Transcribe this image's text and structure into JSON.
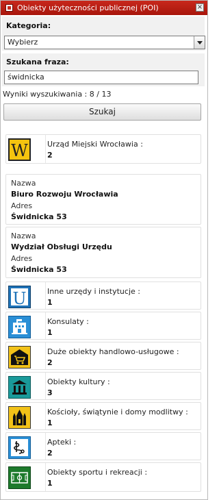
{
  "window": {
    "title": "Obiekty użyteczności publicznej (POI)"
  },
  "category": {
    "label": "Kategoria:",
    "selected": "Wybierz"
  },
  "search": {
    "label": "Szukana fraza:",
    "value": "świdnicka"
  },
  "results": {
    "text": "Wyniki wyszukiwania : 8 / 13"
  },
  "search_button": {
    "label": "Szukaj"
  },
  "first_category": {
    "label": "Urząd Miejski Wrocławia :",
    "count": "2",
    "icon": "letter-w-icon"
  },
  "places": [
    {
      "name_label": "Nazwa",
      "name": "Biuro Rozwoju Wrocławia",
      "address_label": "Adres",
      "address": "Świdnicka 53"
    },
    {
      "name_label": "Nazwa",
      "name": "Wydział Obsługi Urzędu",
      "address_label": "Adres",
      "address": "Świdnicka 53"
    }
  ],
  "categories": [
    {
      "label": "Inne urzędy i instytucje :",
      "count": "1",
      "icon": "letter-u-icon"
    },
    {
      "label": "Konsulaty :",
      "count": "1",
      "icon": "consulate-icon"
    },
    {
      "label": "Duże obiekty handlowo-usługowe :",
      "count": "2",
      "icon": "shopping-cart-icon"
    },
    {
      "label": "Obiekty kultury :",
      "count": "3",
      "icon": "museum-icon"
    },
    {
      "label": "Kościoły, świątynie i domy modlitwy :",
      "count": "1",
      "icon": "church-icon"
    },
    {
      "label": "Apteki :",
      "count": "2",
      "icon": "pharmacy-icon"
    },
    {
      "label": "Obiekty sportu i rekreacji :",
      "count": "1",
      "icon": "sports-field-icon"
    }
  ],
  "colors": {
    "titlebar": "#b81e12",
    "section_bg": "#f1f1f1",
    "card_border": "#e0e0e0"
  }
}
